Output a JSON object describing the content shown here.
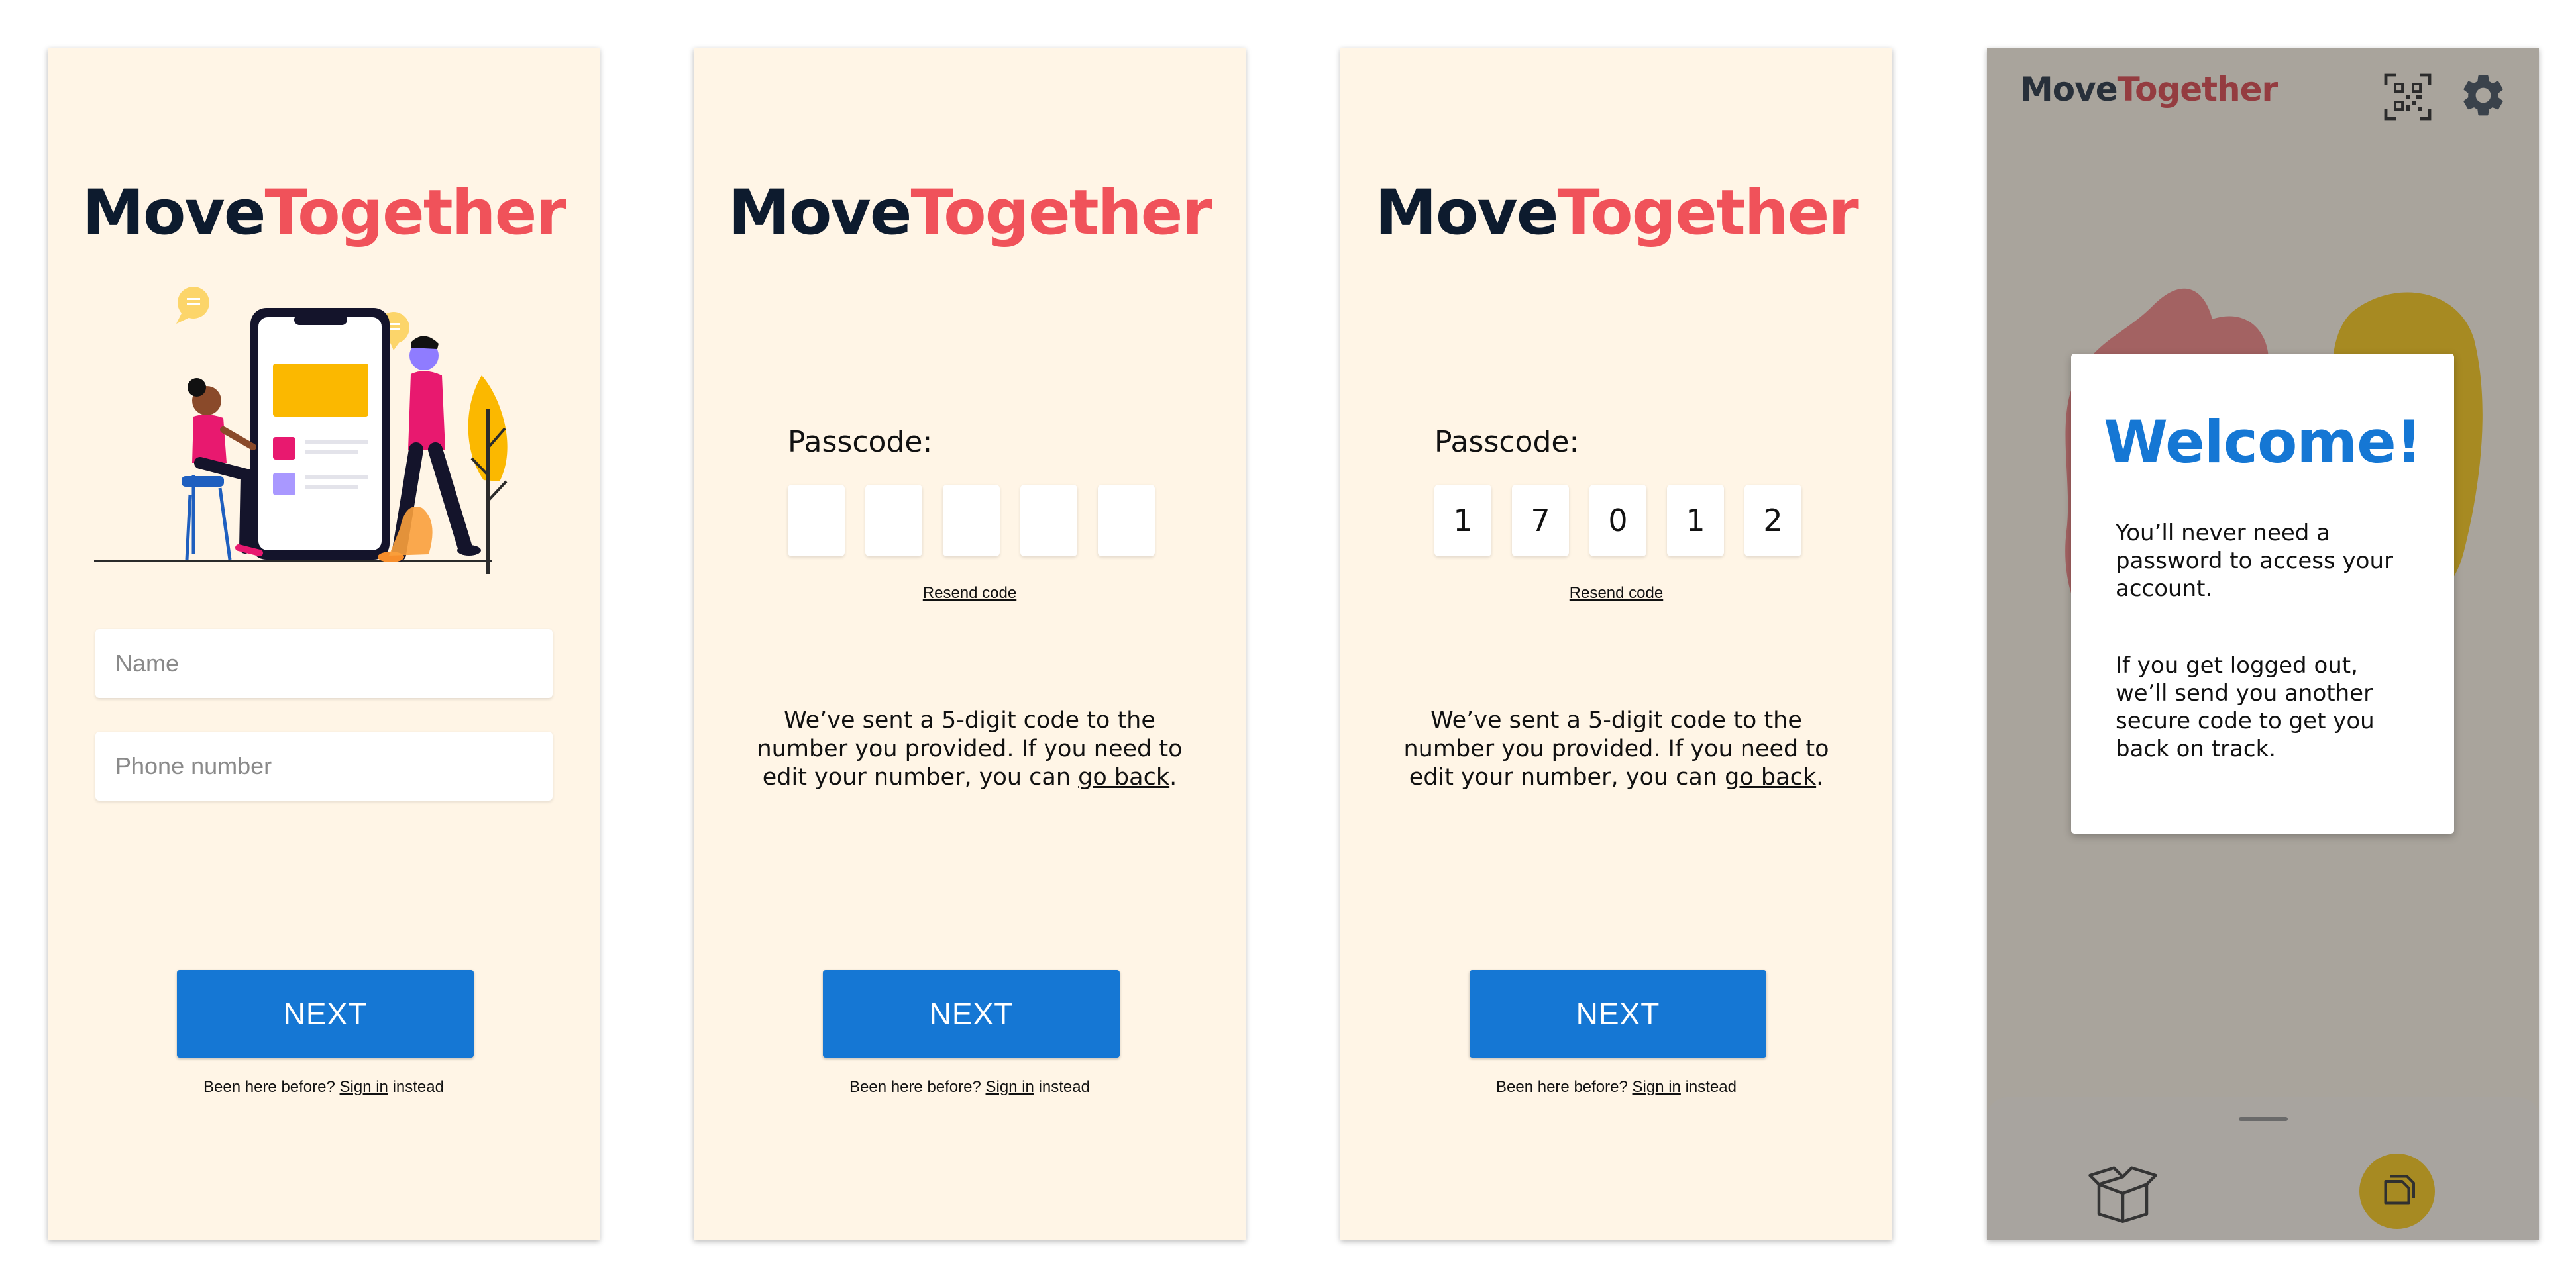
{
  "brand": {
    "part1": "Move",
    "part2": "Together"
  },
  "signup": {
    "name_placeholder": "Name",
    "phone_placeholder": "Phone number"
  },
  "verify": {
    "passcode_label": "Passcode:",
    "resend_label": "Resend code",
    "message_before": "We’ve sent a 5-digit code to the number you provided. If you need to edit your number, you can ",
    "go_back_link": "go back",
    "message_after": ".",
    "entered_code": [
      "1",
      "7",
      "0",
      "1",
      "2"
    ]
  },
  "common": {
    "next_label": "NEXT",
    "signin_prefix": "Been here before? ",
    "signin_link": "Sign in",
    "signin_suffix": " instead"
  },
  "welcome": {
    "title": "Welcome!",
    "paragraph1": "You’ll never need a password to access your account.",
    "paragraph2": "If you get logged out, we’ll send you another secure code to get you back on track."
  },
  "icons": {
    "qr": "qr-code-icon",
    "settings": "gear-icon",
    "box": "open-box-icon",
    "notes": "notes-icon"
  },
  "colors": {
    "brand_dark": "#0d1b2e",
    "brand_accent": "#f0525a",
    "primary_button": "#1577d4",
    "screen_background": "#fff5e6"
  }
}
